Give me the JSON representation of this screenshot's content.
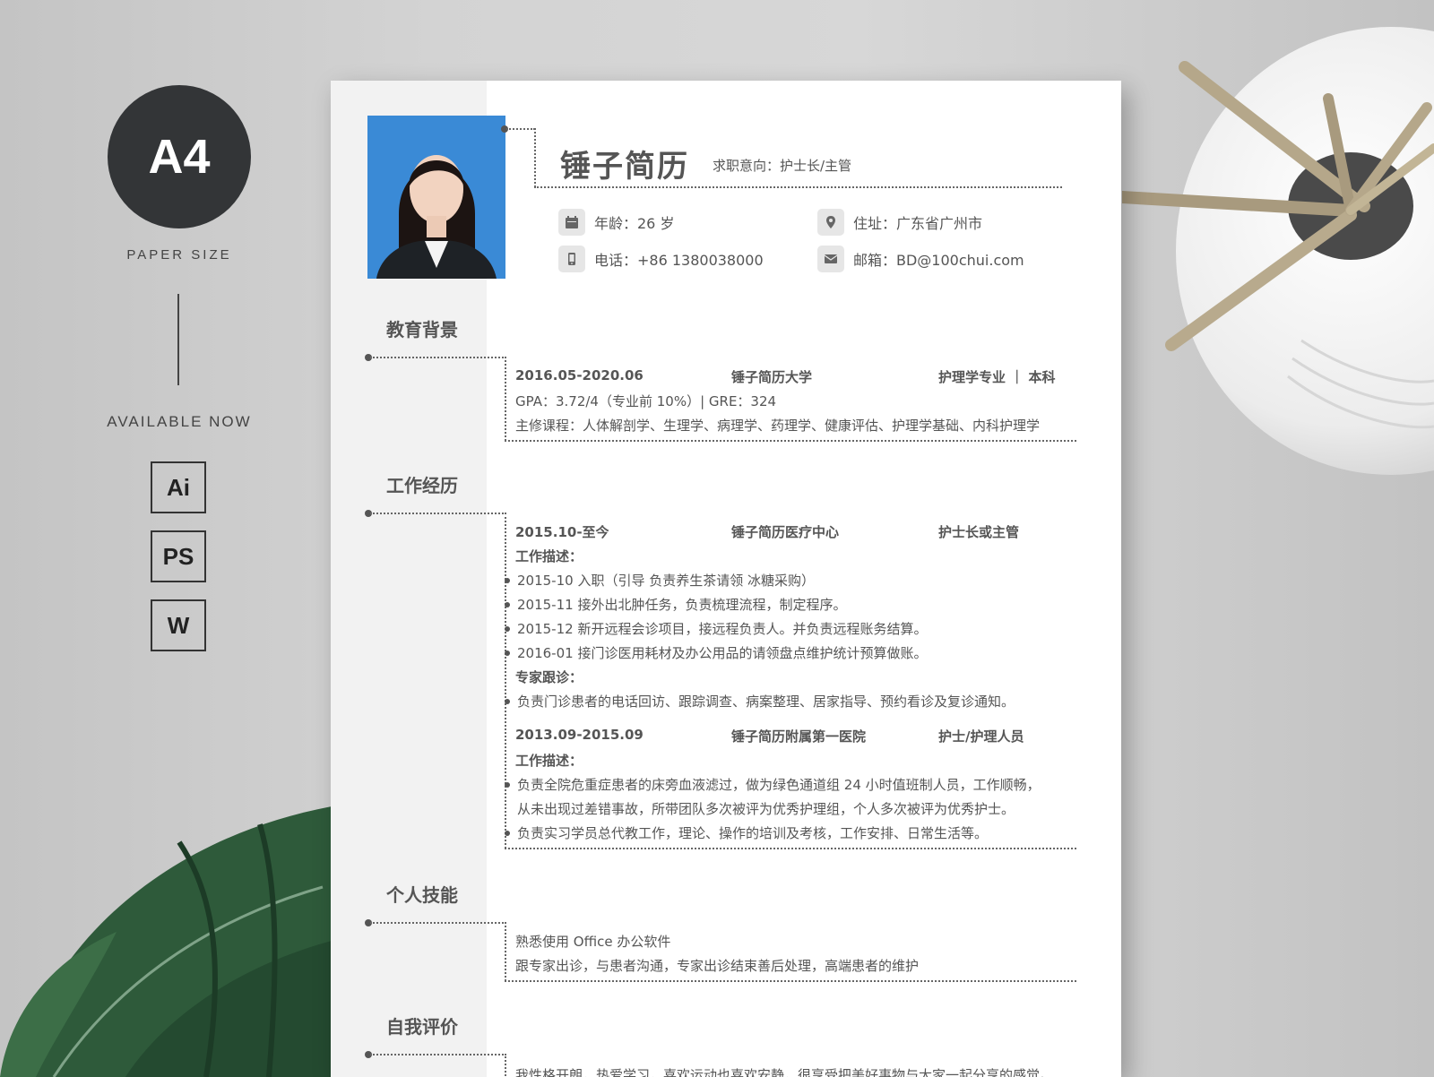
{
  "promo": {
    "paper_badge": "A4",
    "paper_size_label": "PAPER SIZE",
    "available_label": "AVAILABLE NOW",
    "formats": [
      "Ai",
      "PS",
      "W"
    ]
  },
  "resume": {
    "name": "锤子简历",
    "intent": "求职意向：护士长/主管",
    "info": {
      "age": "年龄：26 岁",
      "address": "住址：广东省广州市",
      "phone": "电话：+86 1380038000",
      "email": "邮箱：BD@100chui.com"
    },
    "education": {
      "title": "教育背景",
      "period": "2016.05-2020.06",
      "school": "锤子简历大学",
      "major": "护理学专业 ｜ 本科",
      "gpa": "GPA：3.72/4（专业前 10%）| GRE：324",
      "courses": "主修课程：人体解剖学、生理学、病理学、药理学、健康评估、护理学基础、内科护理学"
    },
    "work": {
      "title": "工作经历",
      "job1": {
        "period": "2015.10-至今",
        "org": "锤子简历医疗中心",
        "role": "护士长或主管",
        "desc_label": "工作描述：",
        "bullets": [
          "2015-10  入职（引导  负责养生茶请领  冰糖采购）",
          "2015-11  接外出北肿任务，负责梳理流程，制定程序。",
          "2015-12  新开远程会诊项目，接远程负责人。并负责远程账务结算。",
          "2016-01  接门诊医用耗材及办公用品的请领盘点维护统计预算做账。"
        ],
        "expert_label": "专家跟诊：",
        "expert_bullets": [
          "负责门诊患者的电话回访、跟踪调查、病案整理、居家指导、预约看诊及复诊通知。"
        ]
      },
      "job2": {
        "period": "2013.09-2015.09",
        "org": "锤子简历附属第一医院",
        "role": "护士/护理人员",
        "desc_label": "工作描述：",
        "bullet1_line1": "负责全院危重症患者的床旁血液滤过，做为绿色通道组 24 小时值班制人员，工作顺畅，",
        "bullet1_line2": "从未出现过差错事故，所带团队多次被评为优秀护理组，个人多次被评为优秀护士。",
        "bullet2": "负责实习学员总代教工作，理论、操作的培训及考核，工作安排、日常生活等。"
      }
    },
    "skills": {
      "title": "个人技能",
      "lines": [
        "熟悉使用 Office 办公软件",
        "跟专家出诊，与患者沟通，专家出诊结束善后处理，高端患者的维护"
      ]
    },
    "self_eval": {
      "title": "自我评价",
      "line1": "我性格开朗，热爱学习，喜欢运动也喜欢安静，很享受把美好事物与大家一起分享的感觉。"
    }
  }
}
